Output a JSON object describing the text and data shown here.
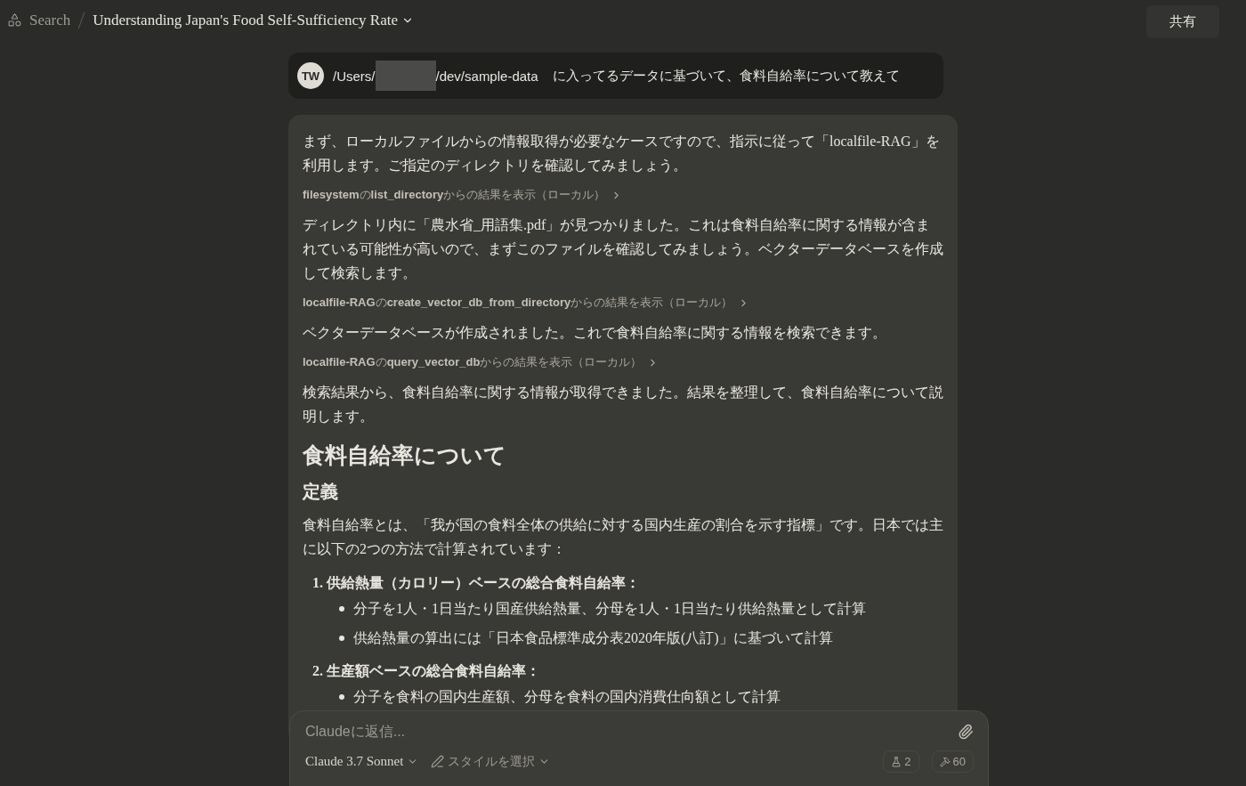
{
  "top_bar": {
    "search_label": "Search",
    "chat_title": "Understanding Japan's Food Self-Sufficiency Rate",
    "share_button": "共有"
  },
  "user_message": {
    "avatar": "TW",
    "path_start": "/Users/",
    "redacted": true,
    "path_end": "/dev/sample-data",
    "text": "に入ってるデータに基づいて、食料自給率について教えて"
  },
  "response": [
    {
      "kind": "paragraph",
      "text": "まず、ローカルファイルからの情報取得が必要なケースですので、指示に従って「localfile-RAG」を利用します。ご指定のディレクトリを確認してみましょう。"
    },
    {
      "kind": "tool",
      "text": "**filesystem**の**list_directory**からの結果を表示（ローカル）"
    },
    {
      "kind": "paragraph",
      "text": "ディレクトリ内に「農水省_用語集.pdf」が見つかりました。これは食料自給率に関する情報が含まれている可能性が高いので、まずこのファイルを確認してみましょう。ベクターデータベースを作成して検索します。"
    },
    {
      "kind": "tool",
      "text": "**localfile-RAG**の**create_vector_db_from_directory**からの結果を表示（ローカル）"
    },
    {
      "kind": "paragraph",
      "text": "ベクターデータベースが作成されました。これで食料自給率に関する情報を検索できます。"
    },
    {
      "kind": "tool",
      "text": "**localfile-RAG**の**query_vector_db**からの結果を表示（ローカル）"
    },
    {
      "kind": "paragraph",
      "text": "検索結果から、食料自給率に関する情報が取得できました。結果を整理して、食料自給率について説明します。"
    },
    {
      "kind": "heading1",
      "text": "食料自給率について"
    },
    {
      "kind": "heading2",
      "text": "定義"
    },
    {
      "kind": "paragraph",
      "text": "食料自給率とは、「我が国の食料全体の供給に対する国内生産の割合を示す指標」です。日本では主に以下の2つの方法で計算されています："
    },
    {
      "kind": "ordered_list",
      "items": [
        {
          "number": "1.",
          "title": "供給熱量（カロリー）ベースの総合食料自給率：",
          "bullets": [
            "分子を1人・1日当たり国産供給熱量、分母を1人・1日当たり供給熱量として計算",
            "供給熱量の算出には「日本食品標準成分表2020年版(八訂)」に基づいて計算"
          ]
        },
        {
          "number": "2.",
          "title": "生産額ベースの総合食料自給率：",
          "bullets": [
            "分子を食料の国内生産額、分母を食料の国内消費仕向額として計算"
          ]
        }
      ]
    }
  ],
  "composer": {
    "placeholder": "Claudeに返信...",
    "model": "Claude 3.7 Sonnet",
    "style": "スタイルを選択",
    "flask_count": "2",
    "tools_count": "60"
  }
}
